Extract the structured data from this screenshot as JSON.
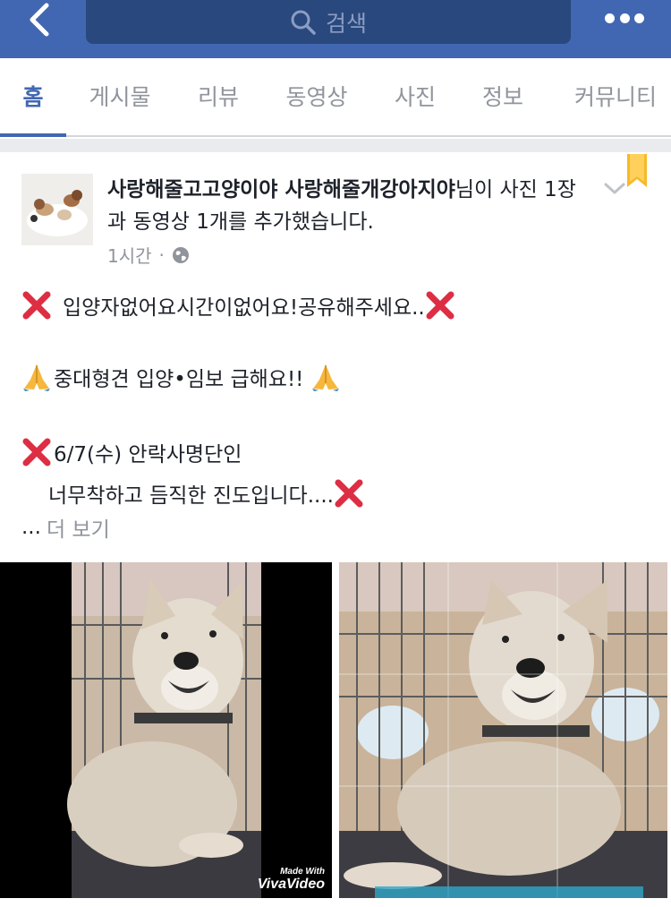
{
  "topbar": {
    "search_placeholder": "검색",
    "back_icon": "chevron-left-icon",
    "more_icon": "more-dots-icon"
  },
  "tabs": [
    {
      "label": "홈",
      "active": true
    },
    {
      "label": "게시물",
      "active": false
    },
    {
      "label": "리뷰",
      "active": false
    },
    {
      "label": "동영상",
      "active": false
    },
    {
      "label": "사진",
      "active": false
    },
    {
      "label": "정보",
      "active": false
    },
    {
      "label": "커뮤니티",
      "active": false
    }
  ],
  "post": {
    "author": "사랑해줄고고양이야 사랑해줄개강아지야",
    "action": "님이 사진 1장과 동영상 1개를 추가했습니다.",
    "time": "1시간",
    "meta_separator": "·",
    "lines": [
      "입양자없어요시간이없어요!공유해주세요..",
      "중대형견 입양•임보 급해요!!",
      "6/7(수) 안락사명단인",
      "너무착하고 듬직한 진도입니다...."
    ],
    "ellipsis": "...",
    "see_more": "더 보기",
    "video_watermark_small": "Made With",
    "video_watermark_big": "VivaVideo"
  },
  "colors": {
    "brand": "#4267b2",
    "search_bg": "#29487d",
    "muted": "#90949c",
    "bookmark": "#f7b928",
    "xmark": "#dd2e44"
  }
}
